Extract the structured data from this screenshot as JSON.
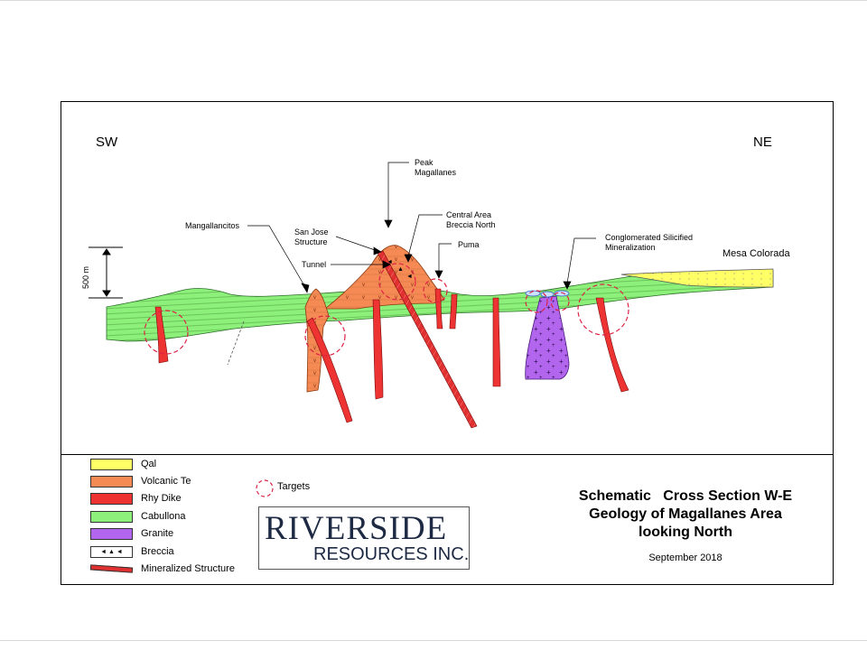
{
  "directions": {
    "left": "SW",
    "right": "NE"
  },
  "scale": {
    "label": "500 m"
  },
  "callouts": {
    "peak": "Peak\nMagallanes",
    "mangallancitos": "Mangallancitos",
    "san_jose": "San Jose\nStructure",
    "central": "Central Area\nBreccia North",
    "puma": "Puma",
    "tunnel": "Tunnel",
    "conglomerated": "Conglomerated Silicified\nMineralization",
    "mesa": "Mesa Colorada"
  },
  "legend": [
    {
      "label": "Qal",
      "color": "#ffff66"
    },
    {
      "label": "Volcanic Te",
      "color": "#f58a54"
    },
    {
      "label": "Rhy Dike",
      "color": "#ee3333"
    },
    {
      "label": "Cabullona",
      "color": "#8cf07a"
    },
    {
      "label": "Granite",
      "color": "#b266ee"
    },
    {
      "label": "Breccia",
      "color": "#ffffff"
    },
    {
      "label": "Mineralized Structure",
      "color": "#e03030"
    }
  ],
  "targets_label": "Targets",
  "logo": {
    "main": "RIVERSIDE",
    "sub": "RESOURCES INC."
  },
  "title": {
    "line1": "Schematic   Cross Section W-E",
    "line2": "Geology of Magallanes Area",
    "line3": "looking North"
  },
  "date": "September 2018",
  "colors": {
    "qal": "#ffff66",
    "volcanic": "#f58a54",
    "dike": "#ee3333",
    "cabullona": "#8cf07a",
    "granite": "#b266ee",
    "target": "#dd2244"
  }
}
